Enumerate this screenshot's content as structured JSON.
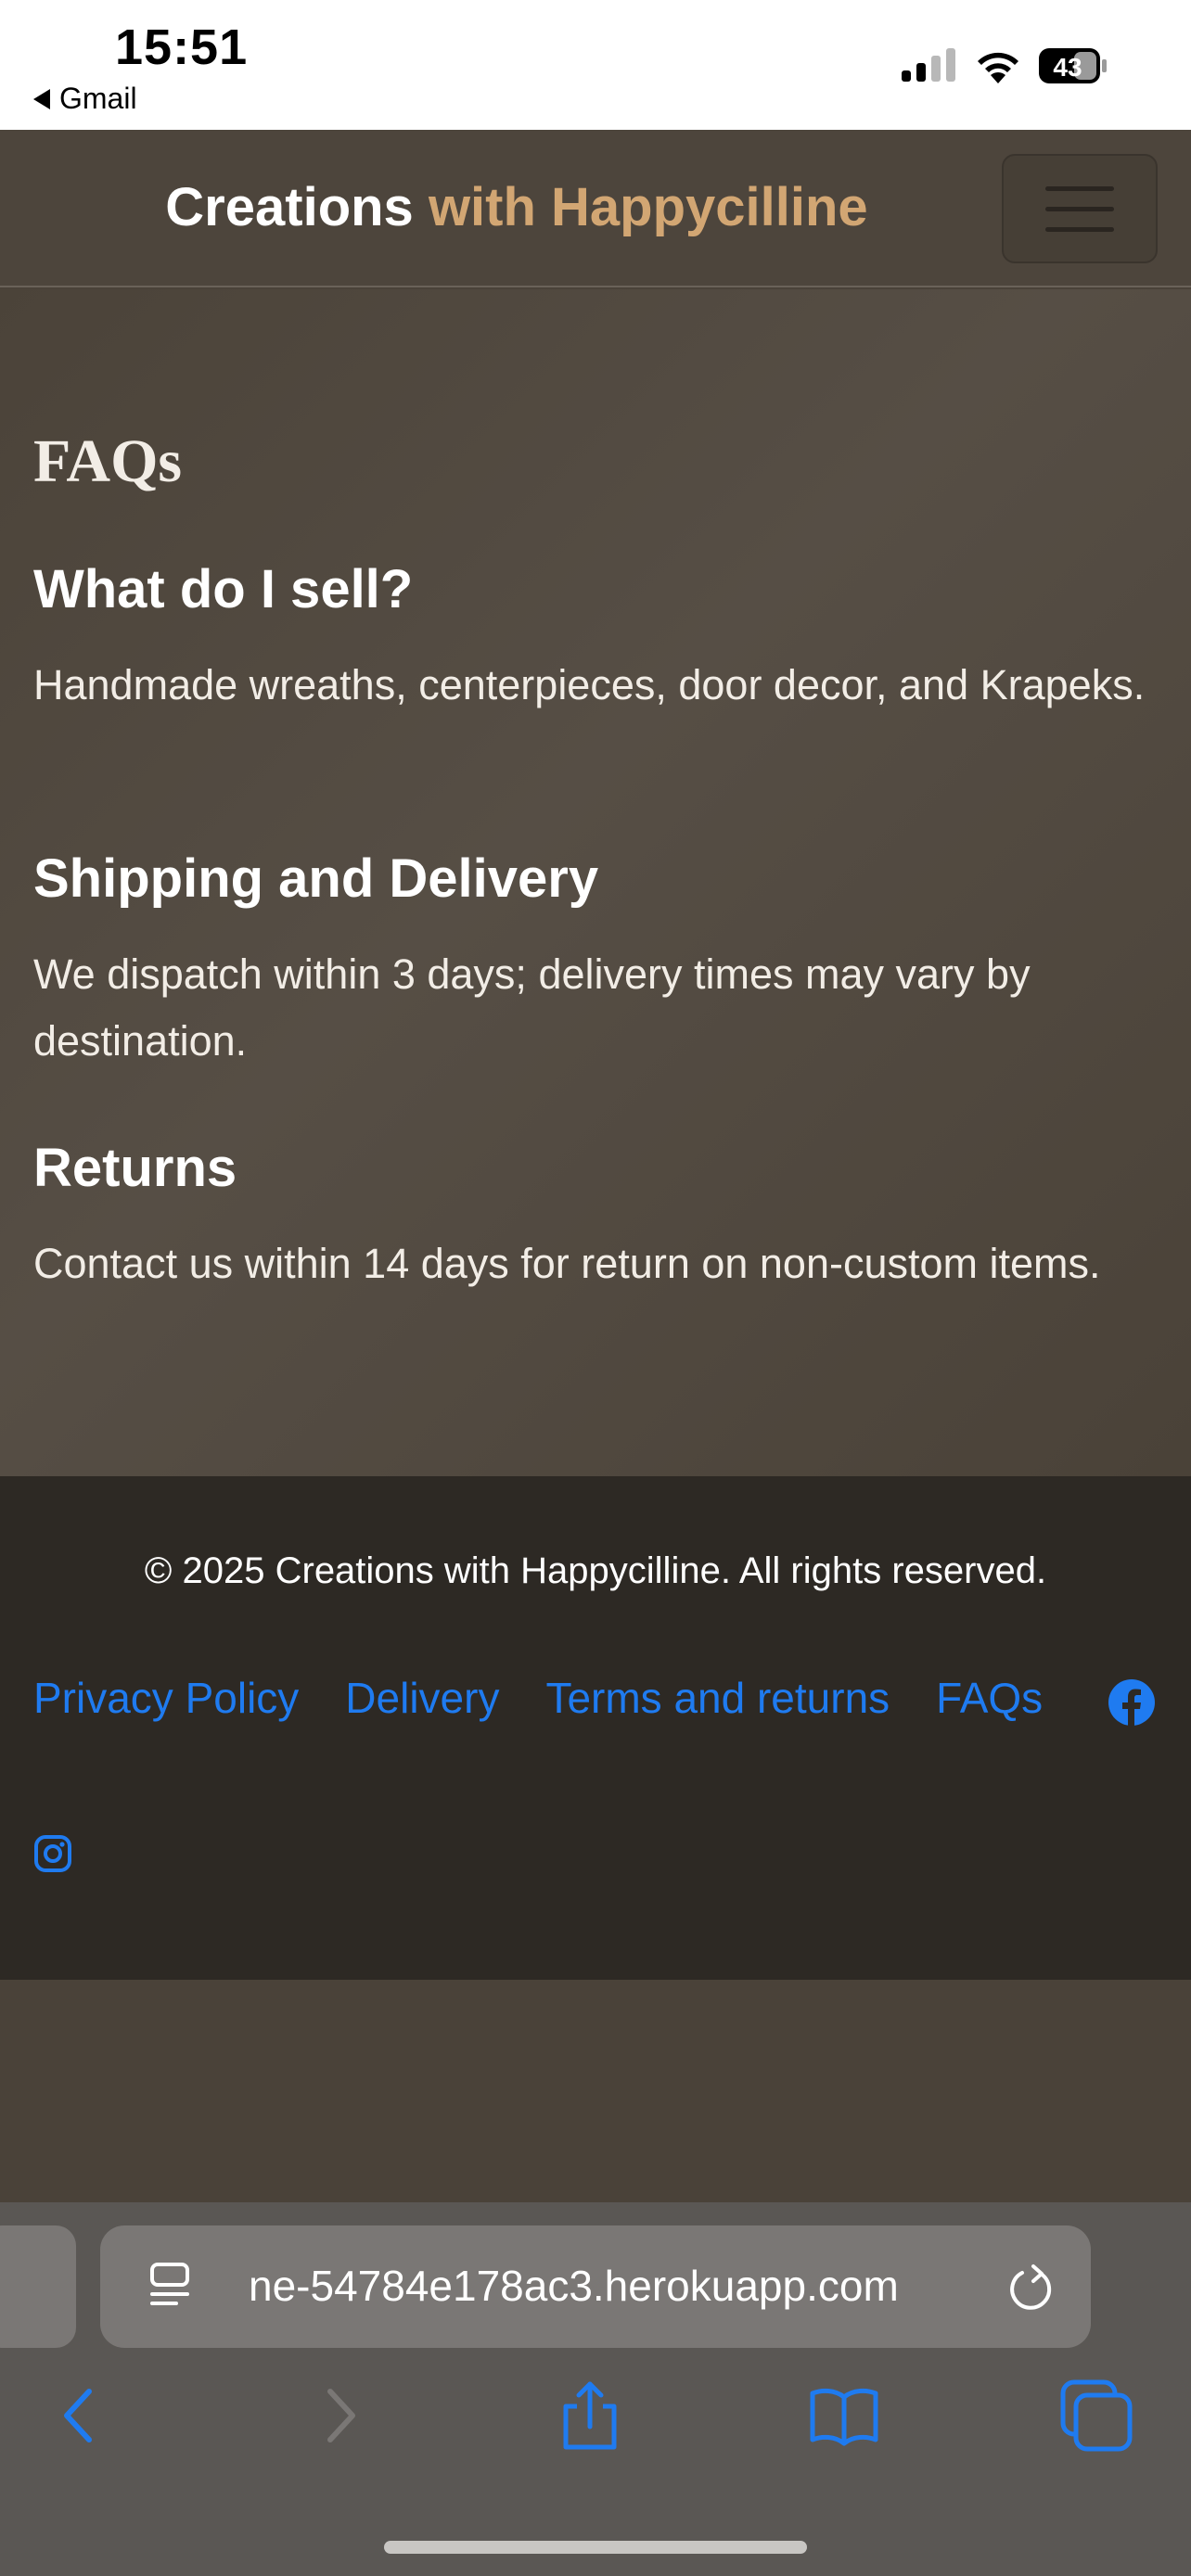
{
  "status_bar": {
    "time": "15:51",
    "back_app": "Gmail",
    "battery": "43"
  },
  "header": {
    "brand_part1": "Creations",
    "brand_part2": "with Happycilline",
    "menu_icon": "hamburger-icon"
  },
  "main": {
    "title": "FAQs",
    "faqs": [
      {
        "question": "What do I sell?",
        "answer": "Handmade wreaths, centerpieces, door decor, and Krapeks."
      },
      {
        "question": "Shipping and Delivery",
        "answer": "We dispatch within 3 days; delivery times may vary by destination."
      },
      {
        "question": "Returns",
        "answer": "Contact us within 14 days for return on non-custom items."
      }
    ]
  },
  "footer": {
    "copyright": "© 2025 Creations with Happycilline. All rights reserved.",
    "links": [
      "Privacy Policy",
      "Delivery",
      "Terms and returns",
      "FAQs"
    ],
    "social": [
      "facebook-icon",
      "instagram-icon"
    ]
  },
  "browser": {
    "url": "ne-54784e178ac3.herokuapp.com"
  },
  "colors": {
    "accent": "#d2a673",
    "link": "#1f7bf0",
    "footer_bg": "#2d2924",
    "page_bg": "#4a4239"
  }
}
